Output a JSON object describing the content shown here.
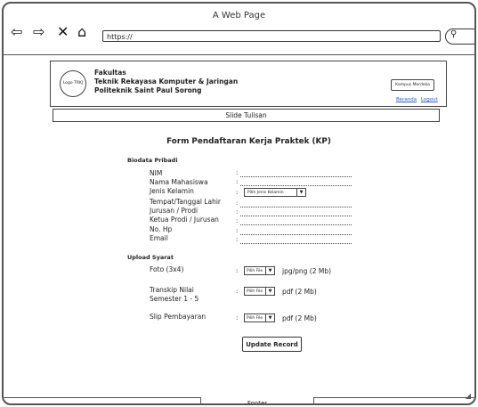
{
  "browser": {
    "title": "A Web Page",
    "url": "https://",
    "search_icon": "search-icon"
  },
  "header": {
    "logo": "Logo TRKJ",
    "line1": "Fakultas",
    "line2": "Teknik Rekayasa Komputer & Jaringan",
    "line3": "Politeknik Saint Paul Sorong",
    "kampus_button": "Kampus Merdeka",
    "link_beranda": "Beranda",
    "link_logout": "Logout"
  },
  "slide": {
    "label": "Slide Tulisan"
  },
  "form": {
    "title": "Form Pendaftaran Kerja Praktek (KP)",
    "biodata_title": "Biodata Pribadi",
    "fields": [
      "NIM",
      "Nama Mahasiswa",
      "Jenis Kelamin",
      "Tempat/Tanggal Lahir",
      "Jurusan / Prodi",
      "Ketua Prodi / Jurusan",
      "No. Hp",
      "Email"
    ],
    "gender_select": "Pilih Jenis Kelamin",
    "upload_title": "Upload Syarat",
    "uploads": {
      "foto_label": "Foto (3x4)",
      "foto_type": "jpg/png (2 Mb)",
      "transkip_label1": "Transkip Nilai",
      "transkip_label2": "Semester 1 - 5",
      "transkip_type": "pdf (2 Mb)",
      "slip_label": "Slip Pembayaran",
      "slip_type": "pdf (2 Mb)",
      "file_button": "Pilih File"
    },
    "submit": "Update Record"
  },
  "footer": {
    "label": "Footer"
  }
}
